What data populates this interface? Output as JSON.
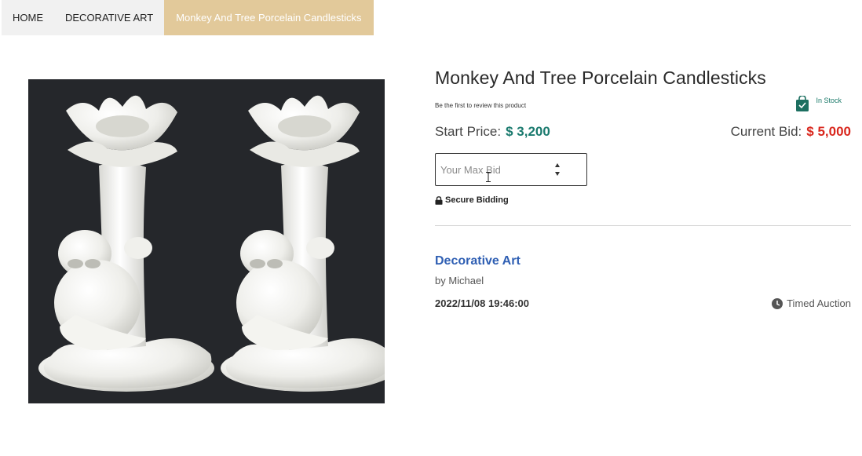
{
  "breadcrumb": {
    "home": "HOME",
    "category": "DECORATIVE ART",
    "current": "Monkey And Tree Porcelain Candlesticks"
  },
  "product": {
    "title": "Monkey And Tree Porcelain Candlesticks",
    "review_link": "Be the first to review this product",
    "stock_status": "In Stock",
    "start_price_label": "Start Price:",
    "start_price_value": "$ 3,200",
    "current_bid_label": "Current Bid:",
    "current_bid_value": "$ 5,000",
    "bid_placeholder": "Your Max Bid",
    "secure_label": "Secure Bidding",
    "category": "Decorative Art",
    "author": "by Michael",
    "datetime": "2022/11/08 19:46:00",
    "auction_type": "Timed Auction",
    "image_icon": "porcelain-candlesticks-photo"
  },
  "colors": {
    "accent": "#e2c99a",
    "start_price": "#1a7a6e",
    "current_bid": "#d9261c",
    "category_link": "#2f5fb3",
    "stock_green": "#1c7a6a"
  }
}
